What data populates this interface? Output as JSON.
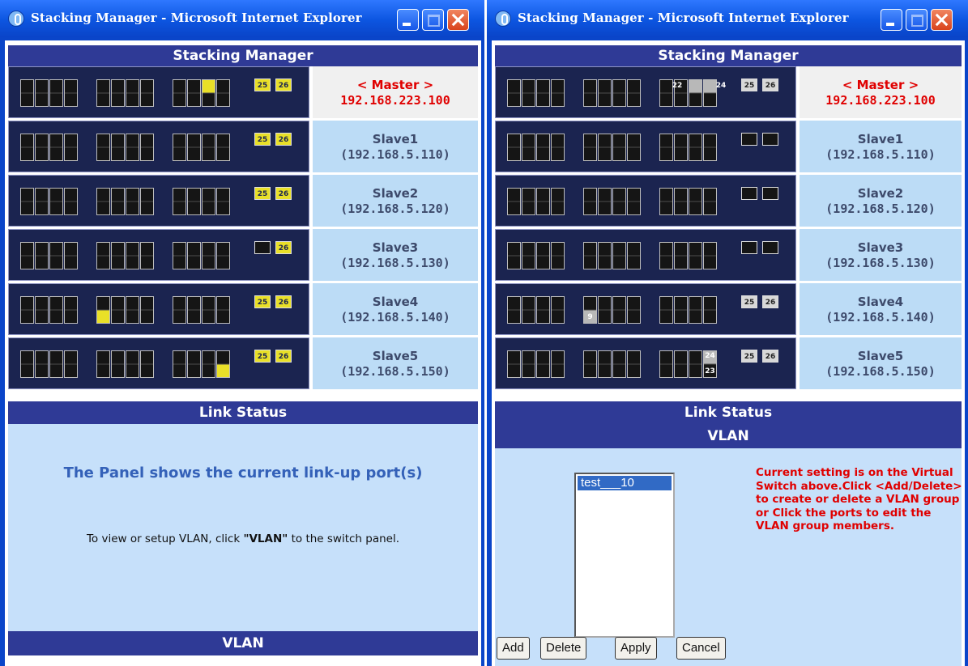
{
  "windows": [
    {
      "title": "Stacking Manager - Microsoft Internet Explorer",
      "header": "Stacking Manager",
      "switches": [
        {
          "label": "< Master >",
          "ip": "192.168.223.100",
          "active_ports": [
            "22"
          ],
          "uplinks": [
            "25",
            "26"
          ]
        },
        {
          "label": "Slave1",
          "ip": "(192.168.5.110)",
          "uplinks": [
            "25",
            "26"
          ]
        },
        {
          "label": "Slave2",
          "ip": "(192.168.5.120)",
          "uplinks": [
            "25",
            "26"
          ]
        },
        {
          "label": "Slave3",
          "ip": "(192.168.5.130)",
          "uplinks": [
            "",
            "26"
          ]
        },
        {
          "label": "Slave4",
          "ip": "(192.168.5.140)",
          "active_ports": [
            "9"
          ],
          "uplinks": [
            "25",
            "26"
          ]
        },
        {
          "label": "Slave5",
          "ip": "(192.168.5.150)",
          "active_ports": [
            "23"
          ],
          "uplinks": [
            "25",
            "26"
          ]
        }
      ],
      "link_status_header": "Link Status",
      "panel_title": "The Panel shows the current link-up port(s)",
      "panel_msg_pre": "To view or setup VLAN, click ",
      "panel_msg_bold": "\"VLAN\"",
      "panel_msg_post": " to the switch panel.",
      "vlan_header": "VLAN"
    },
    {
      "title": "Stacking Manager - Microsoft Internet Explorer",
      "header": "Stacking Manager",
      "switches": [
        {
          "label": "< Master >",
          "ip": "192.168.223.100",
          "port_labels": [
            "22",
            "24"
          ],
          "uplinks": [
            "25",
            "26"
          ]
        },
        {
          "label": "Slave1",
          "ip": "(192.168.5.110)",
          "uplinks": [
            "",
            ""
          ]
        },
        {
          "label": "Slave2",
          "ip": "(192.168.5.120)",
          "uplinks": [
            "",
            ""
          ]
        },
        {
          "label": "Slave3",
          "ip": "(192.168.5.130)",
          "uplinks": [
            "",
            ""
          ]
        },
        {
          "label": "Slave4",
          "ip": "(192.168.5.140)",
          "port_labels": [
            "9"
          ],
          "uplinks": [
            "25",
            "26"
          ]
        },
        {
          "label": "Slave5",
          "ip": "(192.168.5.150)",
          "port_labels": [
            "24",
            "23"
          ],
          "uplinks": [
            "25",
            "26"
          ]
        }
      ],
      "link_status_header": "Link Status",
      "vlan_header": "VLAN",
      "vlan_list": [
        "test___10"
      ],
      "note": "Current setting is on the Virtual Switch above.Click <Add/Delete> to create or delete a VLAN group or Click the ports to edit the VLAN group members.",
      "buttons": {
        "add": "Add",
        "delete": "Delete",
        "apply": "Apply",
        "cancel": "Cancel"
      }
    }
  ],
  "colors": {
    "title_bar": "#0c55e0",
    "header_bar": "#2f3a96",
    "panel_bg": "#c6e0fa",
    "slave_bg": "#bcdcf6",
    "master_text": "#e00000",
    "link_port": "#e9e028"
  }
}
